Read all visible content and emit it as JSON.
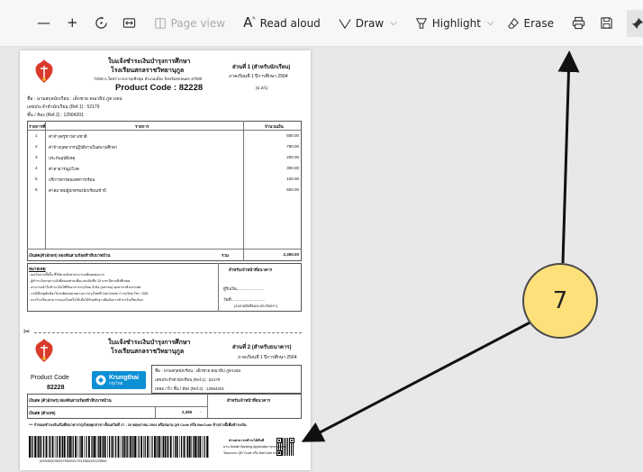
{
  "toolbar": {
    "page_view": "Page view",
    "read_aloud": "Read aloud",
    "draw": "Draw",
    "highlight": "Highlight",
    "erase": "Erase"
  },
  "doc": {
    "top": {
      "title1": "ใบแจ้งชำระเงินบำรุงการศึกษา",
      "title2": "โรงเรียนสกลราชวิทยานุกูล",
      "address": "74/26 ถ.ใสสว่าง ต.ธาตุเชิงชุม อำเภอเมือง จังหวัดสกลนคร 47000",
      "product": "Product Code : 82228",
      "part": "ส่วนที่ 1 (สำหรับนักเรียน)",
      "semester": "ภาคเรียนที่ 1 ปีการศึกษา 2564",
      "pageinfo": "(ม.2/1)",
      "name": "ชื่อ - นามสกุลนักเรียน : เด็กชาย คณาธิป ภูดวงจม",
      "ref1": "เลขประจำตัวนักเรียน (Ref.1) : 52179",
      "ref2": "ชั้น / ห้อง (Ref.2) : 12564201",
      "col_no": "รายการที่",
      "col_item": "รายการ",
      "col_amount": "จำนวนเงิน",
      "rows": [
        {
          "no": "1",
          "item": "ค่าจ้างครูชาวต่างชาติ",
          "amount": "500.00"
        },
        {
          "no": "2",
          "item": "ค่าจ้างบุคลากรปฏิบัติงานในสนามศึกษา",
          "amount": "750.00"
        },
        {
          "no": "3",
          "item": "ประกันอุบัติเหตุ",
          "amount": "200.00"
        },
        {
          "no": "4",
          "item": "ค่าสาธารณูปโภค",
          "amount": "300.00"
        },
        {
          "no": "5",
          "item": "บริการสารสนเทศการเรียน",
          "amount": "100.00"
        },
        {
          "no": "6",
          "item": "ค่าสมาคมผู้ปกครองนักเรียนเข้าปี",
          "amount": "500.00"
        }
      ],
      "total_text": "เงินสด(ตัวอักษร) สองพันสามร้อยห้าสิบบาทถ้วน",
      "total_label": "รวม",
      "total_value": "2,350.00",
      "note_title": "หมายเหตุ",
      "notes": [
        "- ผลเงินจากทั้งสิ้น ที่ได้ตามจัดหาสามารถเพิ่มผลต่อจาก",
        "- ผู้ชำระเงินกรุณาแจ้งชื่อของท่านเพื่อแกลงบันทึก 15 บาท มีคาดสิ่งที่เหมด",
        "- สามารถนำใบชำระเงินให้ที่ธนาคารกรุงไทย จำกัด (มหาชน) ทุกสาขาทั่วประเทศ",
        "- กรณีมีเหตุขัดข้องโปรดติดต่อสายด่วนการกรุงไทยที่ Call Center 0 กรุงไทย โทร. 1551",
        "- ทางโรงเรียนสามารถออกใบเสร็จได้เมื่อได้รับหลักฐานยืนยันการชำระเงินเรียบร้อย"
      ],
      "receiver_title": "สำหรับเจ้าหน้าที่ธนาคาร",
      "receiver_line1": "ผู้รับเงิน........................",
      "receiver_line2": "วันที่..............................",
      "receiver_line3": "(ลงลายมือชื่อและประทับตรา)"
    },
    "bottom": {
      "title1": "ใบแจ้งชำระเงินบำรุงการศึกษา",
      "title2": "โรงเรียนสกลราชวิทยานุกูล",
      "part": "ส่วนที่ 2 (สำหรับธนาคาร)",
      "semester": "ภาคเรียนที่ 1 ปีการศึกษา 2564",
      "product_label": "Product Code",
      "product_code": "82228",
      "bank_name": "Krungthai",
      "bank_sub": "กรุงไทย",
      "name": "ชื่อ - นามสกุลนักเรียน : เด็กชาย คณาธิป ภูดวงจม",
      "ref1": "เลขประจำตัวนักเรียน (Ref.1) : 52179",
      "ref2": "เทอม / ปี / ชั้น / ห้อง (Ref.2) : 12564201",
      "total_text": "เงินสด (ตัวอักษร) สองพันสามร้อยห้าสิบบาทถ้วน",
      "cash_label": "เงินสด (ตัวเลข)",
      "cash_value": "2,350",
      "cash_dash": "-",
      "staff_title": "สำหรับเจ้าหน้าที่ธนาคาร",
      "deadline": "*** กำหนดชำระเงินเริ่มที่ธนาคารกรุงไทยทุกสาขา ตั้งแต่วันที่ 27 - 30 พฤษภาคม 2564 หรือสแกน QR Code หรือ BarCode ข้างล่างนี้เพื่อชำระเงิน",
      "barcode_text": "|099400039297900521791256420123500",
      "qr_note1": "ท่านสามารถชำระได้ทันที",
      "qr_note2": "ผ่าน Mobile Banking Application ทุกธนาคาร",
      "qr_note3": "โดยสแกน QR Code หรือ BarCode ทางนี้"
    }
  },
  "callout": {
    "number": "7"
  },
  "colors": {
    "callout_fill": "#fde07a",
    "arrow": "#111111"
  }
}
